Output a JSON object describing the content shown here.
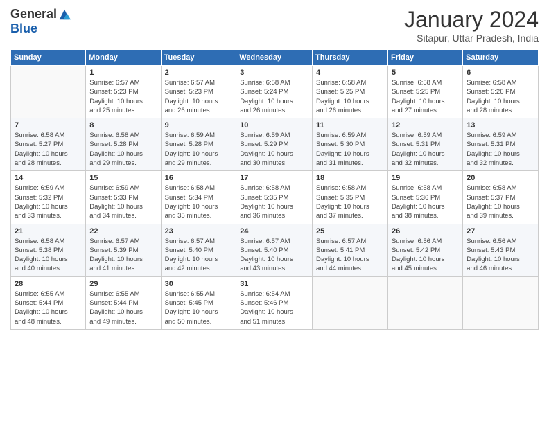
{
  "logo": {
    "general": "General",
    "blue": "Blue"
  },
  "title": "January 2024",
  "location": "Sitapur, Uttar Pradesh, India",
  "days_of_week": [
    "Sunday",
    "Monday",
    "Tuesday",
    "Wednesday",
    "Thursday",
    "Friday",
    "Saturday"
  ],
  "weeks": [
    [
      {
        "day": "",
        "info": ""
      },
      {
        "day": "1",
        "info": "Sunrise: 6:57 AM\nSunset: 5:23 PM\nDaylight: 10 hours\nand 25 minutes."
      },
      {
        "day": "2",
        "info": "Sunrise: 6:57 AM\nSunset: 5:23 PM\nDaylight: 10 hours\nand 26 minutes."
      },
      {
        "day": "3",
        "info": "Sunrise: 6:58 AM\nSunset: 5:24 PM\nDaylight: 10 hours\nand 26 minutes."
      },
      {
        "day": "4",
        "info": "Sunrise: 6:58 AM\nSunset: 5:25 PM\nDaylight: 10 hours\nand 26 minutes."
      },
      {
        "day": "5",
        "info": "Sunrise: 6:58 AM\nSunset: 5:25 PM\nDaylight: 10 hours\nand 27 minutes."
      },
      {
        "day": "6",
        "info": "Sunrise: 6:58 AM\nSunset: 5:26 PM\nDaylight: 10 hours\nand 28 minutes."
      }
    ],
    [
      {
        "day": "7",
        "info": "Sunrise: 6:58 AM\nSunset: 5:27 PM\nDaylight: 10 hours\nand 28 minutes."
      },
      {
        "day": "8",
        "info": "Sunrise: 6:58 AM\nSunset: 5:28 PM\nDaylight: 10 hours\nand 29 minutes."
      },
      {
        "day": "9",
        "info": "Sunrise: 6:59 AM\nSunset: 5:28 PM\nDaylight: 10 hours\nand 29 minutes."
      },
      {
        "day": "10",
        "info": "Sunrise: 6:59 AM\nSunset: 5:29 PM\nDaylight: 10 hours\nand 30 minutes."
      },
      {
        "day": "11",
        "info": "Sunrise: 6:59 AM\nSunset: 5:30 PM\nDaylight: 10 hours\nand 31 minutes."
      },
      {
        "day": "12",
        "info": "Sunrise: 6:59 AM\nSunset: 5:31 PM\nDaylight: 10 hours\nand 32 minutes."
      },
      {
        "day": "13",
        "info": "Sunrise: 6:59 AM\nSunset: 5:31 PM\nDaylight: 10 hours\nand 32 minutes."
      }
    ],
    [
      {
        "day": "14",
        "info": "Sunrise: 6:59 AM\nSunset: 5:32 PM\nDaylight: 10 hours\nand 33 minutes."
      },
      {
        "day": "15",
        "info": "Sunrise: 6:59 AM\nSunset: 5:33 PM\nDaylight: 10 hours\nand 34 minutes."
      },
      {
        "day": "16",
        "info": "Sunrise: 6:58 AM\nSunset: 5:34 PM\nDaylight: 10 hours\nand 35 minutes."
      },
      {
        "day": "17",
        "info": "Sunrise: 6:58 AM\nSunset: 5:35 PM\nDaylight: 10 hours\nand 36 minutes."
      },
      {
        "day": "18",
        "info": "Sunrise: 6:58 AM\nSunset: 5:35 PM\nDaylight: 10 hours\nand 37 minutes."
      },
      {
        "day": "19",
        "info": "Sunrise: 6:58 AM\nSunset: 5:36 PM\nDaylight: 10 hours\nand 38 minutes."
      },
      {
        "day": "20",
        "info": "Sunrise: 6:58 AM\nSunset: 5:37 PM\nDaylight: 10 hours\nand 39 minutes."
      }
    ],
    [
      {
        "day": "21",
        "info": "Sunrise: 6:58 AM\nSunset: 5:38 PM\nDaylight: 10 hours\nand 40 minutes."
      },
      {
        "day": "22",
        "info": "Sunrise: 6:57 AM\nSunset: 5:39 PM\nDaylight: 10 hours\nand 41 minutes."
      },
      {
        "day": "23",
        "info": "Sunrise: 6:57 AM\nSunset: 5:40 PM\nDaylight: 10 hours\nand 42 minutes."
      },
      {
        "day": "24",
        "info": "Sunrise: 6:57 AM\nSunset: 5:40 PM\nDaylight: 10 hours\nand 43 minutes."
      },
      {
        "day": "25",
        "info": "Sunrise: 6:57 AM\nSunset: 5:41 PM\nDaylight: 10 hours\nand 44 minutes."
      },
      {
        "day": "26",
        "info": "Sunrise: 6:56 AM\nSunset: 5:42 PM\nDaylight: 10 hours\nand 45 minutes."
      },
      {
        "day": "27",
        "info": "Sunrise: 6:56 AM\nSunset: 5:43 PM\nDaylight: 10 hours\nand 46 minutes."
      }
    ],
    [
      {
        "day": "28",
        "info": "Sunrise: 6:55 AM\nSunset: 5:44 PM\nDaylight: 10 hours\nand 48 minutes."
      },
      {
        "day": "29",
        "info": "Sunrise: 6:55 AM\nSunset: 5:44 PM\nDaylight: 10 hours\nand 49 minutes."
      },
      {
        "day": "30",
        "info": "Sunrise: 6:55 AM\nSunset: 5:45 PM\nDaylight: 10 hours\nand 50 minutes."
      },
      {
        "day": "31",
        "info": "Sunrise: 6:54 AM\nSunset: 5:46 PM\nDaylight: 10 hours\nand 51 minutes."
      },
      {
        "day": "",
        "info": ""
      },
      {
        "day": "",
        "info": ""
      },
      {
        "day": "",
        "info": ""
      }
    ]
  ]
}
